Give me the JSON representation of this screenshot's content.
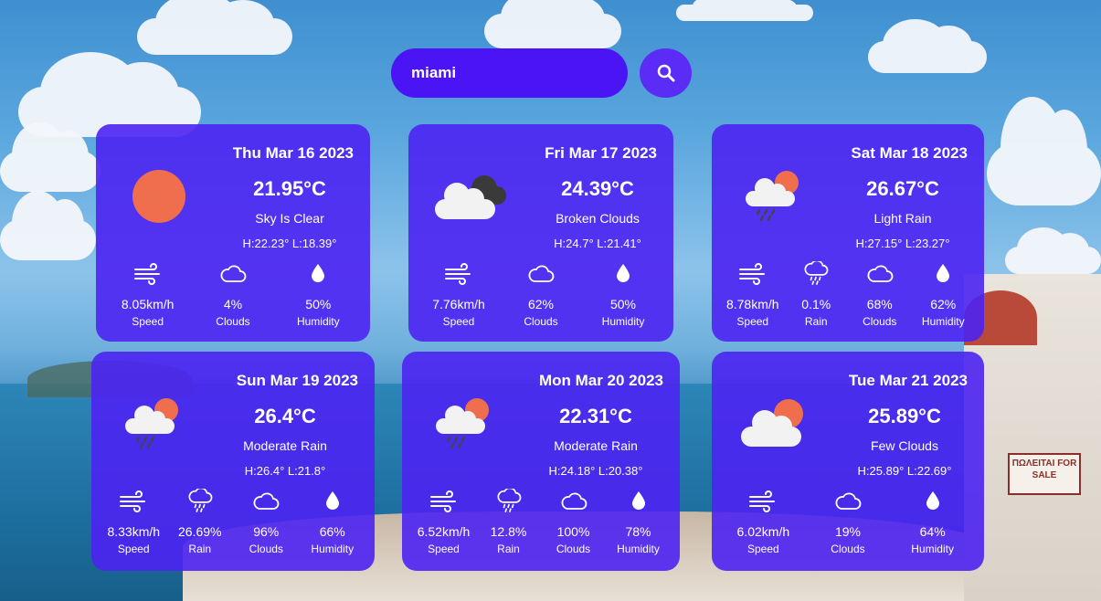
{
  "search": {
    "value": "miami",
    "button_icon": "search-icon"
  },
  "colors": {
    "card": "#4c24f2",
    "search": "#4a14f5",
    "sun": "#ee6e4e",
    "cloud": "#f2f2f2"
  },
  "forecast": [
    {
      "date": "Thu Mar 16 2023",
      "temp": "21.95°C",
      "desc": "Sky Is Clear",
      "hl": "H:22.23° L:18.39°",
      "icon": "sun-icon",
      "stats": [
        {
          "icon": "wind-icon",
          "value": "8.05km/h",
          "label": "Speed"
        },
        {
          "icon": "cloud-icon",
          "value": "4%",
          "label": "Clouds"
        },
        {
          "icon": "drop-icon",
          "value": "50%",
          "label": "Humidity"
        }
      ]
    },
    {
      "date": "Fri Mar 17 2023",
      "temp": "24.39°C",
      "desc": "Broken Clouds",
      "hl": "H:24.7° L:21.41°",
      "icon": "broken-clouds-icon",
      "stats": [
        {
          "icon": "wind-icon",
          "value": "7.76km/h",
          "label": "Speed"
        },
        {
          "icon": "cloud-icon",
          "value": "62%",
          "label": "Clouds"
        },
        {
          "icon": "drop-icon",
          "value": "50%",
          "label": "Humidity"
        }
      ]
    },
    {
      "date": "Sat Mar 18 2023",
      "temp": "26.67°C",
      "desc": "Light Rain",
      "hl": "H:27.15° L:23.27°",
      "icon": "sun-cloud-rain-icon",
      "stats": [
        {
          "icon": "wind-icon",
          "value": "8.78km/h",
          "label": "Speed"
        },
        {
          "icon": "rain-icon",
          "value": "0.1%",
          "label": "Rain"
        },
        {
          "icon": "cloud-icon",
          "value": "68%",
          "label": "Clouds"
        },
        {
          "icon": "drop-icon",
          "value": "62%",
          "label": "Humidity"
        }
      ]
    },
    {
      "date": "Sun Mar 19 2023",
      "temp": "26.4°C",
      "desc": "Moderate Rain",
      "hl": "H:26.4° L:21.8°",
      "icon": "sun-cloud-rain-icon",
      "stats": [
        {
          "icon": "wind-icon",
          "value": "8.33km/h",
          "label": "Speed"
        },
        {
          "icon": "rain-icon",
          "value": "26.69%",
          "label": "Rain"
        },
        {
          "icon": "cloud-icon",
          "value": "96%",
          "label": "Clouds"
        },
        {
          "icon": "drop-icon",
          "value": "66%",
          "label": "Humidity"
        }
      ]
    },
    {
      "date": "Mon Mar 20 2023",
      "temp": "22.31°C",
      "desc": "Moderate Rain",
      "hl": "H:24.18° L:20.38°",
      "icon": "sun-cloud-rain-icon",
      "stats": [
        {
          "icon": "wind-icon",
          "value": "6.52km/h",
          "label": "Speed"
        },
        {
          "icon": "rain-icon",
          "value": "12.8%",
          "label": "Rain"
        },
        {
          "icon": "cloud-icon",
          "value": "100%",
          "label": "Clouds"
        },
        {
          "icon": "drop-icon",
          "value": "78%",
          "label": "Humidity"
        }
      ]
    },
    {
      "date": "Tue Mar 21 2023",
      "temp": "25.89°C",
      "desc": "Few Clouds",
      "hl": "H:25.89° L:22.69°",
      "icon": "sun-cloud-icon",
      "stats": [
        {
          "icon": "wind-icon",
          "value": "6.02km/h",
          "label": "Speed"
        },
        {
          "icon": "cloud-icon",
          "value": "19%",
          "label": "Clouds"
        },
        {
          "icon": "drop-icon",
          "value": "64%",
          "label": "Humidity"
        }
      ]
    }
  ],
  "background": {
    "sign_text": "ΠΩΛΕΙΤΑΙ FOR SALE"
  }
}
